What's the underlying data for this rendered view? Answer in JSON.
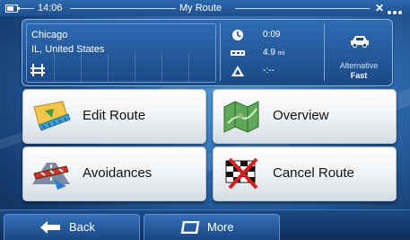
{
  "status_bar": {
    "time": "14:06",
    "title": "My Route",
    "close_glyph": "✕"
  },
  "route_info": {
    "destination_city": "Chicago",
    "destination_region": "IL, United States",
    "time_remaining": "0:09",
    "distance": "4.9",
    "distance_unit": "mi",
    "arrival": "-:--",
    "alternative_label": "Alternative",
    "alternative_value": "Fast"
  },
  "menu": {
    "edit_route": "Edit Route",
    "overview": "Overview",
    "avoidances": "Avoidances",
    "cancel_route": "Cancel Route"
  },
  "bottom_bar": {
    "back": "Back",
    "more": "More"
  },
  "colors": {
    "background": "#2f6db3",
    "panel": "#1a4986",
    "button_face": "#eef1f4",
    "text_dark": "#111111"
  },
  "icons": {
    "battery": "battery-icon",
    "close": "close-icon",
    "menu_dots": "dots-icon",
    "road": "road-icon",
    "clock": "clock-icon",
    "distance": "distance-icon",
    "arrival": "flag-icon",
    "car": "car-icon",
    "edit_route": "ruler-map-icon",
    "overview": "map-icon",
    "avoidances": "road-block-icon",
    "cancel_route": "checkered-flag-icon",
    "back": "arrow-left-icon",
    "more": "more-icon"
  }
}
